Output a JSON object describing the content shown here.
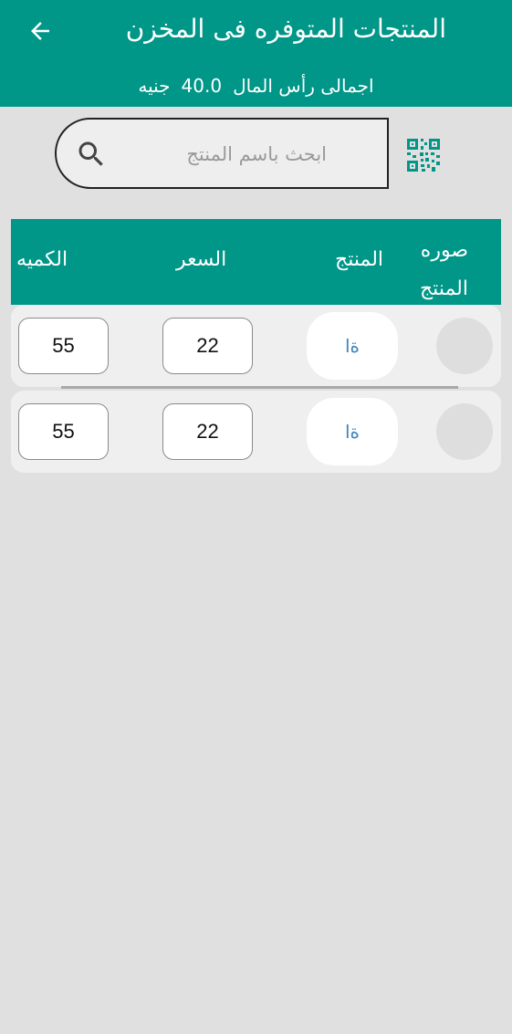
{
  "appbar": {
    "title": "المنتجات المتوفره فى المخزن",
    "back_icon": "arrow-back-icon",
    "capital_label": "اجمالى رأس المال",
    "capital_value": "40.0",
    "currency": "جنيه"
  },
  "search": {
    "placeholder": "ابحث باسم المنتج",
    "search_icon": "search-icon",
    "qr_icon": "qr-code-icon"
  },
  "table": {
    "headers": {
      "image": "صوره المنتج",
      "product": "المنتج",
      "price": "السعر",
      "quantity": "الكميه"
    },
    "rows": [
      {
        "name": "ةا",
        "price": "22",
        "quantity": "55"
      },
      {
        "name": "ةا",
        "price": "22",
        "quantity": "55"
      }
    ]
  },
  "colors": {
    "primary": "#009688",
    "background": "#e0e0e0",
    "row_background": "#efefef",
    "product_text": "#3f84b8"
  }
}
